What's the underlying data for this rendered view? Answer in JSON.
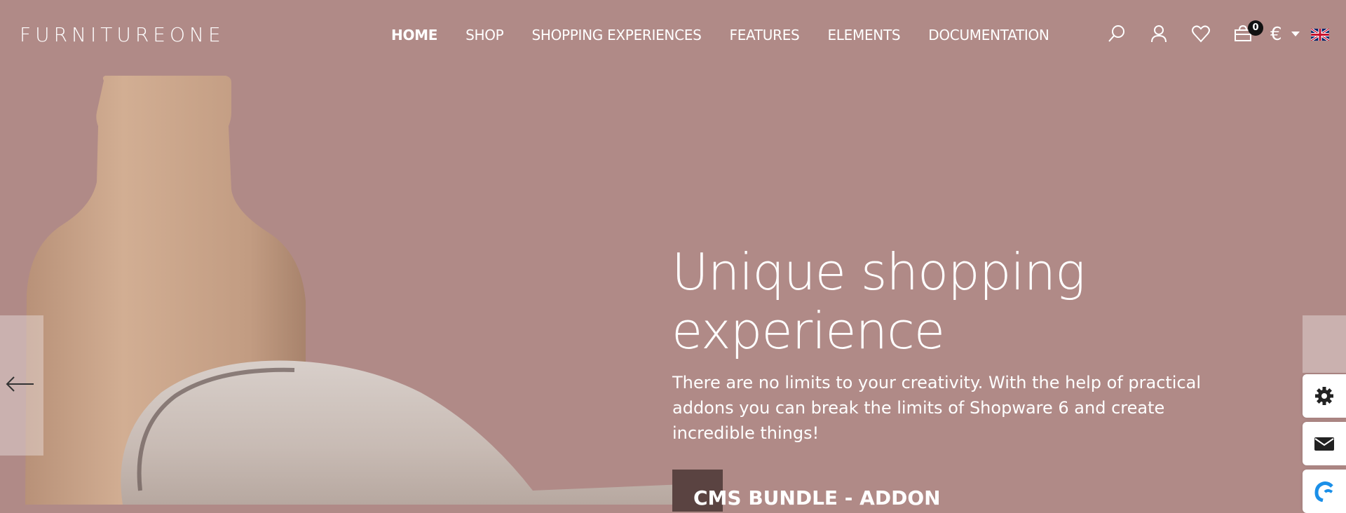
{
  "header": {
    "logo": "FURNITUREONE",
    "nav": [
      {
        "label": "HOME",
        "active": true
      },
      {
        "label": "SHOP"
      },
      {
        "label": "SHOPPING EXPERIENCES"
      },
      {
        "label": "FEATURES"
      },
      {
        "label": "ELEMENTS"
      },
      {
        "label": "DOCUMENTATION"
      }
    ],
    "cart_count": "0",
    "currency": "€"
  },
  "hero": {
    "title_line1": "Unique shopping",
    "title_line2": "experience",
    "text": "There are no limits to your creativity. With the help of practical addons you can break the limits of Shopware 6 and create incredible things!",
    "button_label": "CMS BUNDLE - ADDON"
  },
  "colors": {
    "background": "#b08a87",
    "vase": "#c9a287",
    "chair": "#cdc1bb",
    "button_block": "#5a4341",
    "accent_blue": "#1a8fe8"
  }
}
